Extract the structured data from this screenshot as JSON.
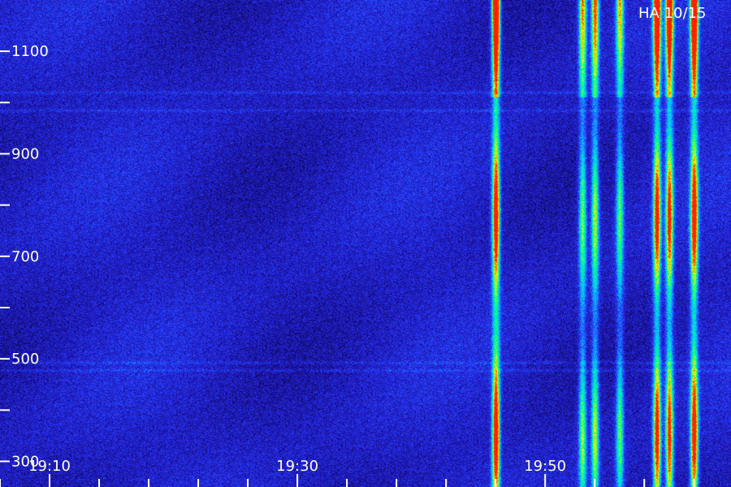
{
  "title": "HA 10/15",
  "chart_data": {
    "type": "heatmap",
    "title": "HA 10/15",
    "xlabel": "",
    "ylabel": "",
    "x_range": [
      "19:06",
      "20:05"
    ],
    "y_range": [
      250,
      1200
    ],
    "x_ticks": [
      {
        "time": "19:06",
        "label": ""
      },
      {
        "time": "19:10",
        "label": "19:10"
      },
      {
        "time": "19:14",
        "label": ""
      },
      {
        "time": "19:18",
        "label": ""
      },
      {
        "time": "19:22",
        "label": ""
      },
      {
        "time": "19:26",
        "label": ""
      },
      {
        "time": "19:30",
        "label": "19:30"
      },
      {
        "time": "19:34",
        "label": ""
      },
      {
        "time": "19:38",
        "label": ""
      },
      {
        "time": "19:42",
        "label": ""
      },
      {
        "time": "19:46",
        "label": ""
      },
      {
        "time": "19:50",
        "label": "19:50"
      },
      {
        "time": "19:54",
        "label": ""
      },
      {
        "time": "19:58",
        "label": ""
      },
      {
        "time": "20:02",
        "label": ""
      }
    ],
    "y_ticks": [
      {
        "value": 300,
        "label": "300"
      },
      {
        "value": 400,
        "label": ""
      },
      {
        "value": 500,
        "label": "500"
      },
      {
        "value": 600,
        "label": ""
      },
      {
        "value": 700,
        "label": "700"
      },
      {
        "value": 800,
        "label": ""
      },
      {
        "value": 900,
        "label": "900"
      },
      {
        "value": 1000,
        "label": ""
      },
      {
        "value": 1100,
        "label": "1100"
      }
    ],
    "colormap": [
      "#000000",
      "#1a10a0",
      "#2a3cff",
      "#00c8ff",
      "#00ff80",
      "#ffff00",
      "#ff2000"
    ],
    "emission_lines": [
      {
        "time": "19:46",
        "intensity": 1.0
      },
      {
        "time": "19:53",
        "intensity": 0.55
      },
      {
        "time": "19:54",
        "intensity": 0.6
      },
      {
        "time": "19:56",
        "intensity": 0.5
      },
      {
        "time": "19:59",
        "intensity": 0.9
      },
      {
        "time": "20:00",
        "intensity": 0.85
      },
      {
        "time": "20:02",
        "intensity": 0.95
      }
    ],
    "noise_bands": [
      1020,
      985,
      493,
      478
    ]
  }
}
